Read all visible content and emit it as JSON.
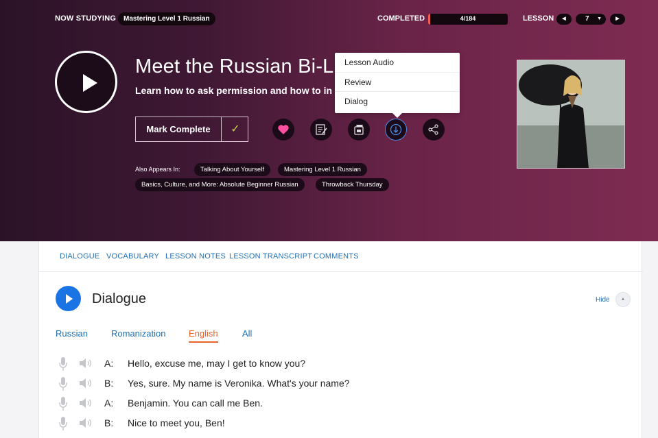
{
  "topbar": {
    "now_studying_label": "NOW STUDYING",
    "course_name": "Mastering Level 1 Russian",
    "completed_label": "COMPLETED",
    "progress_text": "4/184",
    "progress_fraction": 0.0217,
    "lesson_label": "LESSON",
    "prev_icon": "triangle-left-icon",
    "next_icon": "triangle-right-icon",
    "lesson_number": "7"
  },
  "lesson": {
    "title": "Meet the Russian Bi-Li",
    "subtitle": "Learn how to ask permission and how to in",
    "mark_complete_label": "Mark Complete",
    "check_glyph": "✓",
    "actions": [
      "heart-icon",
      "notes-icon",
      "flashcard-icon",
      "download-icon",
      "share-icon"
    ],
    "appears_in_label": "Also Appears In:",
    "tags": [
      "Talking About Yourself",
      "Mastering Level 1 Russian",
      "Basics, Culture, and More: Absolute Beginner Russian",
      "Throwback Thursday"
    ]
  },
  "download_menu": {
    "items": [
      "Lesson Audio",
      "Review",
      "Dialog"
    ]
  },
  "tabs": [
    "DIALOGUE",
    "VOCABULARY",
    "LESSON NOTES",
    "LESSON TRANSCRIPT",
    "COMMENTS"
  ],
  "dialogue": {
    "title": "Dialogue",
    "hide_label": "Hide",
    "languages": [
      "Russian",
      "Romanization",
      "English",
      "All"
    ],
    "active_language": "English",
    "lines": [
      {
        "speaker": "A:",
        "text": "Hello, excuse me, may I get to know you?"
      },
      {
        "speaker": "B:",
        "text": "Yes, sure. My name is Veronika. What's your name?"
      },
      {
        "speaker": "A:",
        "text": "Benjamin. You can call me Ben."
      },
      {
        "speaker": "B:",
        "text": "Nice to meet you, Ben!"
      }
    ]
  },
  "colors": {
    "accent_blue": "#1b74e4",
    "link_blue": "#1f6fb6",
    "active_orange": "#e8632b",
    "heart_pink": "#ff4fa0",
    "check_green": "#c8d64a",
    "progress_red": "#f35c56"
  }
}
